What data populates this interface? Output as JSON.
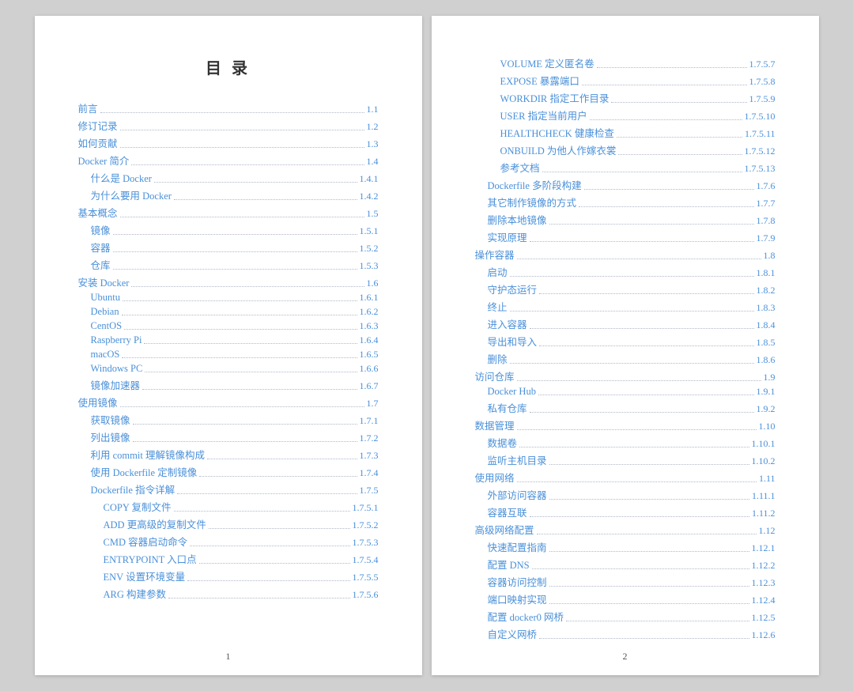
{
  "page1": {
    "title": "目 录",
    "page_number": "1",
    "items": [
      {
        "label": "前言",
        "num": "1.1",
        "indent": 0
      },
      {
        "label": "修订记录",
        "num": "1.2",
        "indent": 0
      },
      {
        "label": "如何贡献",
        "num": "1.3",
        "indent": 0
      },
      {
        "label": "Docker 简介",
        "num": "1.4",
        "indent": 0
      },
      {
        "label": "什么是 Docker",
        "num": "1.4.1",
        "indent": 1
      },
      {
        "label": "为什么要用 Docker",
        "num": "1.4.2",
        "indent": 1
      },
      {
        "label": "基本概念",
        "num": "1.5",
        "indent": 0
      },
      {
        "label": "镜像",
        "num": "1.5.1",
        "indent": 1
      },
      {
        "label": "容器",
        "num": "1.5.2",
        "indent": 1
      },
      {
        "label": "仓库",
        "num": "1.5.3",
        "indent": 1
      },
      {
        "label": "安装 Docker",
        "num": "1.6",
        "indent": 0
      },
      {
        "label": "Ubuntu",
        "num": "1.6.1",
        "indent": 1
      },
      {
        "label": "Debian",
        "num": "1.6.2",
        "indent": 1
      },
      {
        "label": "CentOS",
        "num": "1.6.3",
        "indent": 1
      },
      {
        "label": "Raspberry Pi",
        "num": "1.6.4",
        "indent": 1
      },
      {
        "label": "macOS",
        "num": "1.6.5",
        "indent": 1
      },
      {
        "label": "Windows PC",
        "num": "1.6.6",
        "indent": 1
      },
      {
        "label": "镜像加速器",
        "num": "1.6.7",
        "indent": 1
      },
      {
        "label": "使用镜像",
        "num": "1.7",
        "indent": 0
      },
      {
        "label": "获取镜像",
        "num": "1.7.1",
        "indent": 1
      },
      {
        "label": "列出镜像",
        "num": "1.7.2",
        "indent": 1
      },
      {
        "label": "利用 commit 理解镜像构成",
        "num": "1.7.3",
        "indent": 1
      },
      {
        "label": "使用 Dockerfile 定制镜像",
        "num": "1.7.4",
        "indent": 1
      },
      {
        "label": "Dockerfile 指令详解",
        "num": "1.7.5",
        "indent": 1
      },
      {
        "label": "COPY 复制文件",
        "num": "1.7.5.1",
        "indent": 2
      },
      {
        "label": "ADD 更高级的复制文件",
        "num": "1.7.5.2",
        "indent": 2
      },
      {
        "label": "CMD 容器启动命令",
        "num": "1.7.5.3",
        "indent": 2
      },
      {
        "label": "ENTRYPOINT 入口点",
        "num": "1.7.5.4",
        "indent": 2
      },
      {
        "label": "ENV 设置环境变量",
        "num": "1.7.5.5",
        "indent": 2
      },
      {
        "label": "ARG 构建参数",
        "num": "1.7.5.6",
        "indent": 2
      }
    ]
  },
  "page2": {
    "page_number": "2",
    "items": [
      {
        "label": "VOLUME 定义匿名卷",
        "num": "1.7.5.7",
        "indent": 2
      },
      {
        "label": "EXPOSE 暴露端口",
        "num": "1.7.5.8",
        "indent": 2
      },
      {
        "label": "WORKDIR 指定工作目录",
        "num": "1.7.5.9",
        "indent": 2
      },
      {
        "label": "USER 指定当前用户",
        "num": "1.7.5.10",
        "indent": 2
      },
      {
        "label": "HEALTHCHECK 健康检查",
        "num": "1.7.5.11",
        "indent": 2
      },
      {
        "label": "ONBUILD 为他人作嫁衣裳",
        "num": "1.7.5.12",
        "indent": 2
      },
      {
        "label": "参考文档",
        "num": "1.7.5.13",
        "indent": 2
      },
      {
        "label": "Dockerfile 多阶段构建",
        "num": "1.7.6",
        "indent": 1
      },
      {
        "label": "其它制作镜像的方式",
        "num": "1.7.7",
        "indent": 1
      },
      {
        "label": "删除本地镜像",
        "num": "1.7.8",
        "indent": 1
      },
      {
        "label": "实现原理",
        "num": "1.7.9",
        "indent": 1
      },
      {
        "label": "操作容器",
        "num": "1.8",
        "indent": 0
      },
      {
        "label": "启动",
        "num": "1.8.1",
        "indent": 1
      },
      {
        "label": "守护态运行",
        "num": "1.8.2",
        "indent": 1
      },
      {
        "label": "终止",
        "num": "1.8.3",
        "indent": 1
      },
      {
        "label": "进入容器",
        "num": "1.8.4",
        "indent": 1
      },
      {
        "label": "导出和导入",
        "num": "1.8.5",
        "indent": 1
      },
      {
        "label": "删除",
        "num": "1.8.6",
        "indent": 1
      },
      {
        "label": "访问仓库",
        "num": "1.9",
        "indent": 0
      },
      {
        "label": "Docker Hub",
        "num": "1.9.1",
        "indent": 1
      },
      {
        "label": "私有仓库",
        "num": "1.9.2",
        "indent": 1
      },
      {
        "label": "数据管理",
        "num": "1.10",
        "indent": 0
      },
      {
        "label": "数据卷",
        "num": "1.10.1",
        "indent": 1
      },
      {
        "label": "监听主机目录",
        "num": "1.10.2",
        "indent": 1
      },
      {
        "label": "使用网络",
        "num": "1.11",
        "indent": 0
      },
      {
        "label": "外部访问容器",
        "num": "1.11.1",
        "indent": 1
      },
      {
        "label": "容器互联",
        "num": "1.11.2",
        "indent": 1
      },
      {
        "label": "高级网络配置",
        "num": "1.12",
        "indent": 0
      },
      {
        "label": "快速配置指南",
        "num": "1.12.1",
        "indent": 1
      },
      {
        "label": "配置 DNS",
        "num": "1.12.2",
        "indent": 1
      },
      {
        "label": "容器访问控制",
        "num": "1.12.3",
        "indent": 1
      },
      {
        "label": "端口映射实现",
        "num": "1.12.4",
        "indent": 1
      },
      {
        "label": "配置 docker0 网桥",
        "num": "1.12.5",
        "indent": 1
      },
      {
        "label": "自定义网桥",
        "num": "1.12.6",
        "indent": 1
      }
    ]
  }
}
